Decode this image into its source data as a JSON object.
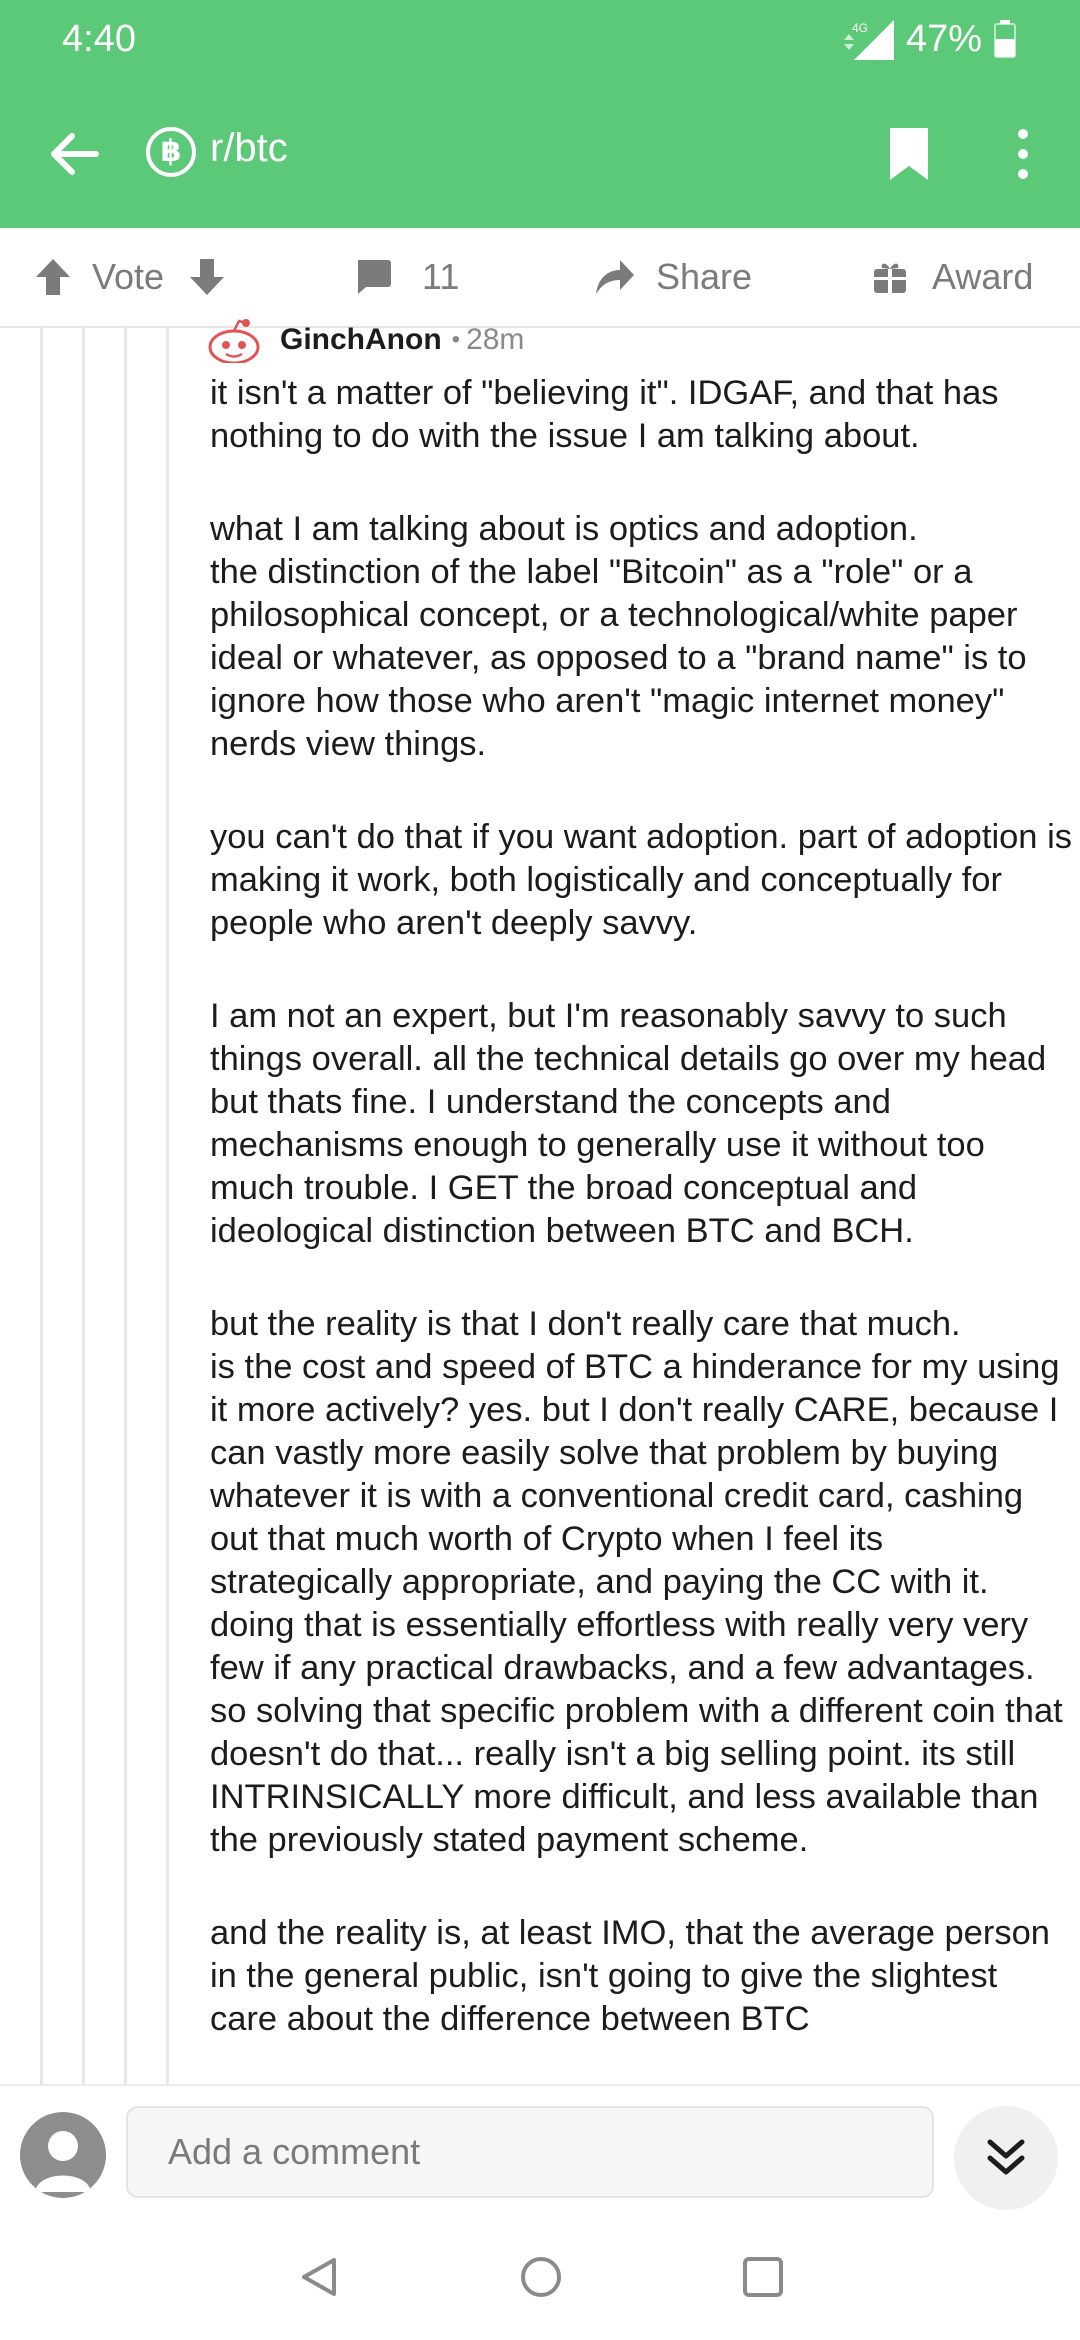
{
  "status_bar": {
    "time": "4:40",
    "network": "4G",
    "battery_percent": "47%"
  },
  "app_bar": {
    "subreddit": "r/btc",
    "subreddit_icon_glyph": "฿",
    "icons": [
      "back-arrow-icon",
      "bitcoin-icon",
      "bookmark-icon",
      "more-vertical-icon"
    ]
  },
  "action_bar": {
    "vote_label": "Vote",
    "comment_count": "11",
    "share_label": "Share",
    "award_label": "Award"
  },
  "comment": {
    "author": "GinchAnon",
    "separator": "•",
    "age": "28m",
    "paragraphs": [
      "it isn't a matter of \"believing it\".  IDGAF, and that has nothing to do with the issue I am talking about.",
      "what I am talking about is optics and adoption.\nthe distinction of the label \"Bitcoin\" as a \"role\" or a philosophical concept, or a technological/white paper ideal or whatever,  as opposed to a \"brand name\" is to ignore how those who aren't \"magic internet money\" nerds view things.",
      "you can't do that if you want adoption.   part of adoption is making it work, both logistically and conceptually for people who aren't deeply savvy.",
      "I am not an expert, but I'm reasonably savvy to such things overall.  all the technical details go over my head but thats fine.   I understand the concepts and mechanisms enough to generally use it without too much trouble.   I GET the broad conceptual and ideological distinction between BTC and BCH.",
      "but the reality is that I don't really care that much.\nis the cost and speed of BTC a hinderance for my using it more actively?  yes.  but I don't really CARE, because I can vastly more easily solve that problem by buying whatever it is with a conventional credit card, cashing out that much worth of Crypto when I feel its strategically appropriate, and paying the CC with it.  doing that is essentially effortless with really very very few if any practical drawbacks, and a few advantages.   so solving that specific problem with a different coin that doesn't do that... really isn't a big selling point.  its still INTRINSICALLY more difficult, and less available than the previously stated payment scheme.",
      "and the reality is, at least IMO,  that the average person in the general public, isn't going to give the slightest care about the difference between BTC"
    ]
  },
  "composer": {
    "placeholder": "Add a comment"
  },
  "colors": {
    "brand_green": "#5cc978",
    "text": "#1c1c1c",
    "muted": "#7b7b7b"
  }
}
